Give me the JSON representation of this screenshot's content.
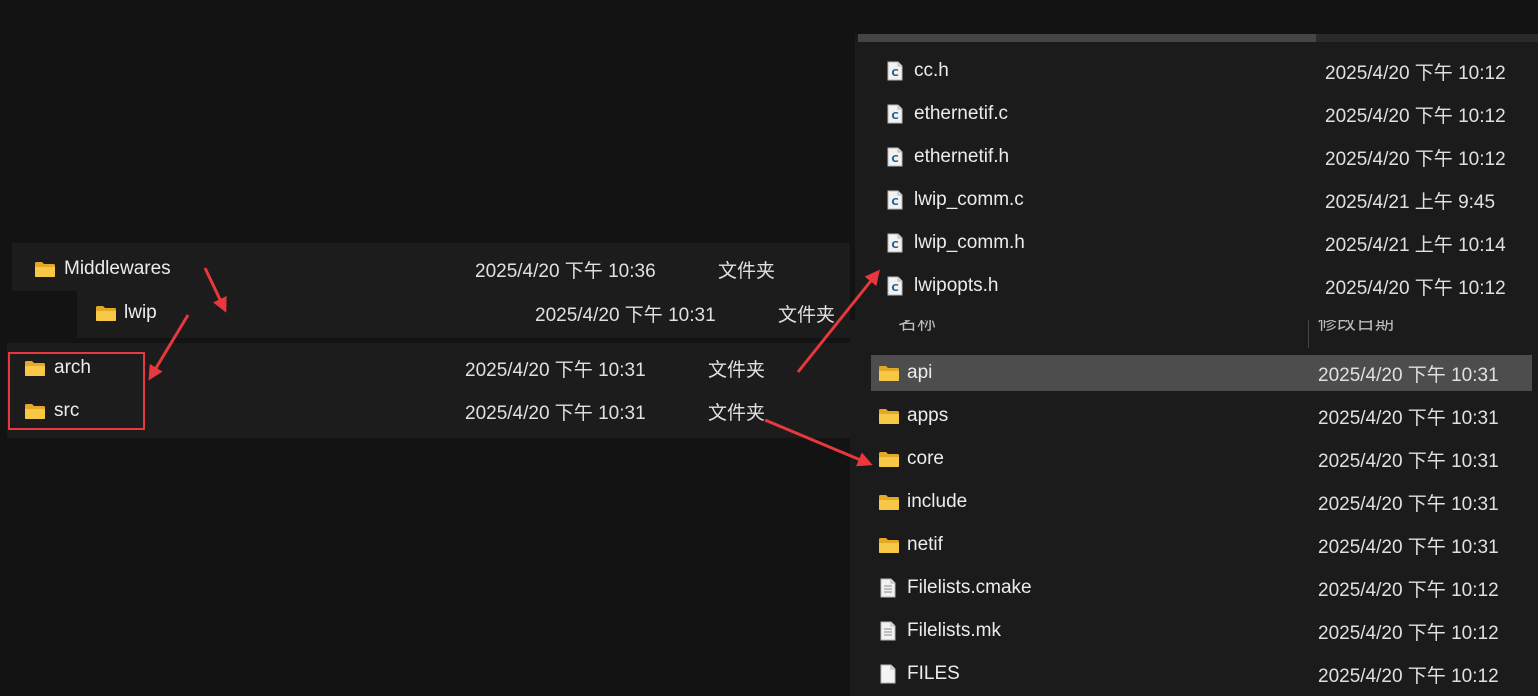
{
  "left_panel": {
    "middlewares": {
      "name": "Middlewares",
      "date": "2025/4/20 下午 10:36",
      "type": "文件夹"
    },
    "lwip": {
      "name": "lwip",
      "date": "2025/4/20 下午 10:31",
      "type": "文件夹"
    },
    "arch": {
      "name": "arch",
      "date": "2025/4/20 下午 10:31",
      "type": "文件夹"
    },
    "src": {
      "name": "src",
      "date": "2025/4/20 下午 10:31",
      "type": "文件夹"
    }
  },
  "arch_files": [
    {
      "name": "cc.h",
      "date": "2025/4/20 下午 10:12"
    },
    {
      "name": "ethernetif.c",
      "date": "2025/4/20 下午 10:12"
    },
    {
      "name": "ethernetif.h",
      "date": "2025/4/20 下午 10:12"
    },
    {
      "name": "lwip_comm.c",
      "date": "2025/4/21 上午 9:45"
    },
    {
      "name": "lwip_comm.h",
      "date": "2025/4/21 上午 10:14"
    },
    {
      "name": "lwipopts.h",
      "date": "2025/4/20 下午 10:12"
    }
  ],
  "src_header": {
    "name_col": "名称",
    "date_col": "修改日期"
  },
  "src_files": [
    {
      "name": "api",
      "date": "2025/4/20 下午 10:31",
      "kind": "folder"
    },
    {
      "name": "apps",
      "date": "2025/4/20 下午 10:31",
      "kind": "folder"
    },
    {
      "name": "core",
      "date": "2025/4/20 下午 10:31",
      "kind": "folder"
    },
    {
      "name": "include",
      "date": "2025/4/20 下午 10:31",
      "kind": "folder"
    },
    {
      "name": "netif",
      "date": "2025/4/20 下午 10:31",
      "kind": "folder"
    },
    {
      "name": "Filelists.cmake",
      "date": "2025/4/20 下午 10:12",
      "kind": "text-file"
    },
    {
      "name": "Filelists.mk",
      "date": "2025/4/20 下午 10:12",
      "kind": "text-file"
    },
    {
      "name": "FILES",
      "date": "2025/4/20 下午 10:12",
      "kind": "blank-file"
    }
  ],
  "colors": {
    "highlight_red": "#e8383d",
    "folder_yellow": "#f6c43c",
    "c_badge": "#1f5c8c",
    "selected_row": "#4d4d4d"
  },
  "icons": {
    "folder": "folder-icon",
    "c_source": "c-file-icon",
    "text_file": "text-file-icon",
    "blank_file": "blank-file-icon"
  }
}
